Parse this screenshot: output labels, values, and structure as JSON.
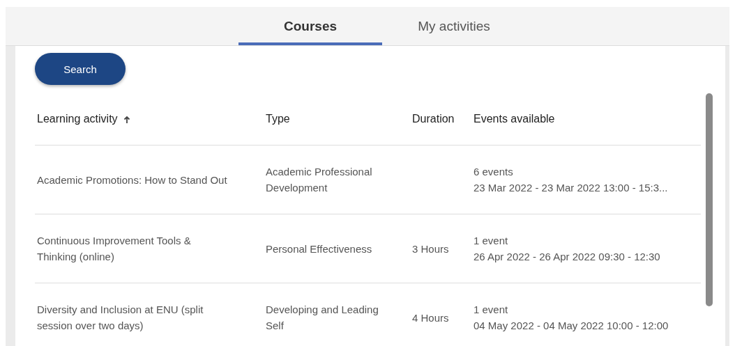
{
  "tabs": [
    {
      "label": "Courses",
      "selected": true
    },
    {
      "label": "My activities",
      "selected": false
    }
  ],
  "search_button": {
    "label": "Search"
  },
  "table": {
    "columns": [
      {
        "label": "Learning activity",
        "sorted_ascending": true
      },
      {
        "label": "Type"
      },
      {
        "label": "Duration"
      },
      {
        "label": "Events available"
      }
    ],
    "rows": [
      {
        "activity": "Academic Promotions: How to Stand Out",
        "type": "Academic Professional Development",
        "events_count": "6 events",
        "events_dates": "23 Mar 2022 - 23 Mar 2022 13:00 - 15:3..."
      },
      {
        "activity": "Continuous Improvement Tools & Thinking (online)",
        "type": "Personal Effectiveness",
        "duration": "3 Hours",
        "events_count": "1 event",
        "events_dates": "26 Apr 2022 - 26 Apr 2022 09:30 - 12:30"
      },
      {
        "activity": "Diversity and Inclusion at ENU (split session over two days)",
        "type": "Developing and Leading Self",
        "duration": "4 Hours",
        "events_count": "1 event",
        "events_dates": "04 May 2022 - 04 May 2022 10:00 - 12:00"
      }
    ]
  }
}
